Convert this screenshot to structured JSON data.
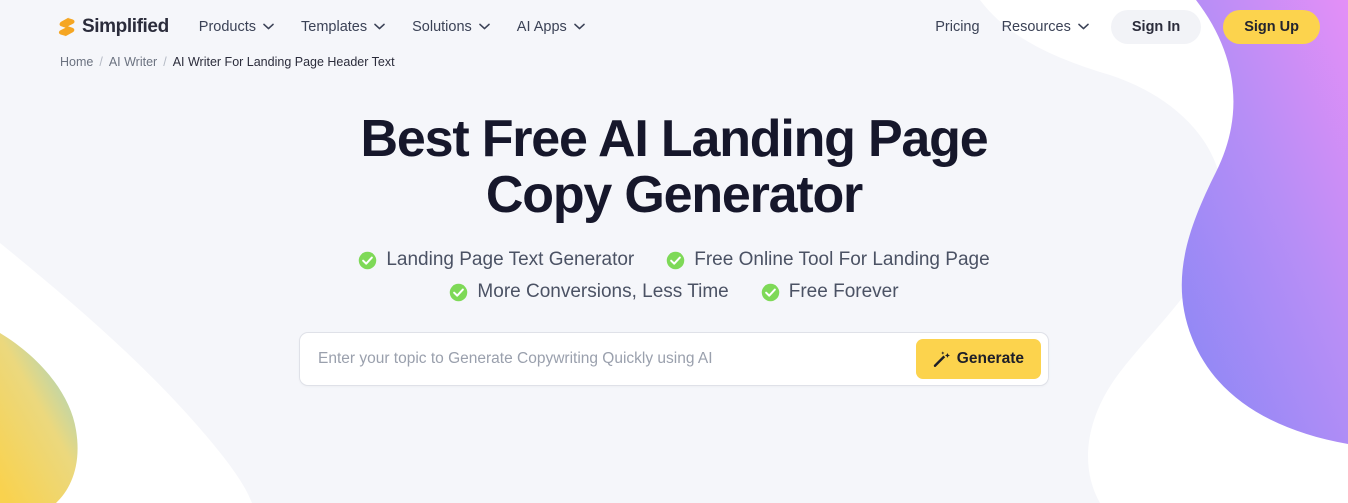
{
  "brand": {
    "name": "Simplified",
    "logo_icon": "lightning-s-logo",
    "logo_color": "#f5a623"
  },
  "nav": {
    "items": [
      {
        "label": "Products",
        "has_dropdown": true,
        "icon": "chevron-down-icon"
      },
      {
        "label": "Templates",
        "has_dropdown": true,
        "icon": "chevron-down-icon"
      },
      {
        "label": "Solutions",
        "has_dropdown": true,
        "icon": "chevron-down-icon"
      },
      {
        "label": "AI Apps",
        "has_dropdown": true,
        "icon": "chevron-down-icon"
      }
    ],
    "pricing_label": "Pricing",
    "resources_label": "Resources",
    "resources_icon": "chevron-down-icon",
    "sign_in_label": "Sign In",
    "sign_up_label": "Sign Up",
    "sign_up_color": "#fcd34d"
  },
  "breadcrumb": {
    "home": "Home",
    "sep": "/",
    "section": "AI Writer",
    "current": "AI Writer For Landing Page Header Text"
  },
  "hero": {
    "title": "Best Free AI Landing Page Copy Generator",
    "features": [
      {
        "label": "Landing Page Text Generator",
        "icon": "check-circle-icon"
      },
      {
        "label": "Free Online Tool For Landing Page",
        "icon": "check-circle-icon"
      },
      {
        "label": "More Conversions, Less Time",
        "icon": "check-circle-icon"
      },
      {
        "label": "Free Forever",
        "icon": "check-circle-icon"
      }
    ],
    "check_color": "#7ed957"
  },
  "search": {
    "placeholder": "Enter your topic to Generate Copywriting Quickly using AI",
    "value": "",
    "button_label": "Generate",
    "button_icon": "magic-wand-icon",
    "button_color": "#fcd34d"
  },
  "theme": {
    "page_background": "#f5f6fa",
    "heading_color": "#16172b",
    "blob_purple_from": "#dd8ef5",
    "blob_purple_to": "#8b87f5",
    "blob_yellow": "#f8d14f",
    "blob_teal": "#9ed9d4"
  }
}
